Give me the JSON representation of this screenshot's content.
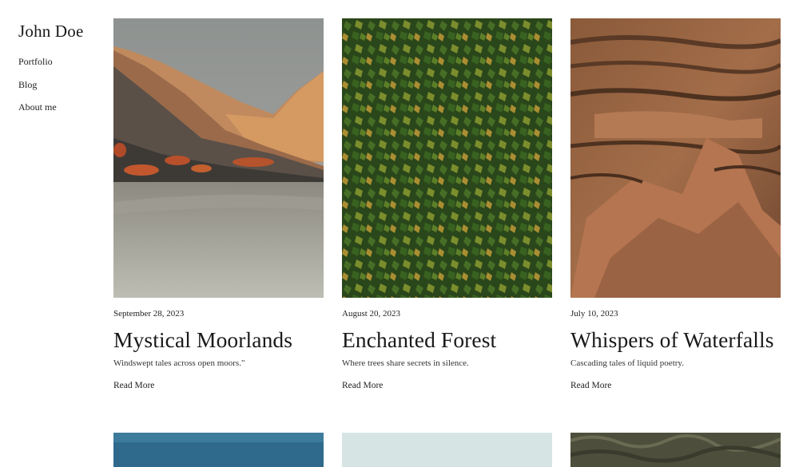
{
  "site": {
    "title": "John Doe"
  },
  "nav": {
    "items": [
      {
        "label": "Portfolio"
      },
      {
        "label": "Blog"
      },
      {
        "label": "About me"
      }
    ]
  },
  "posts": [
    {
      "date": "September 28, 2023",
      "title": "Mystical Moorlands",
      "excerpt": "Windswept tales across open moors.\"",
      "read_more": "Read More",
      "image": "mountain-valley-photo"
    },
    {
      "date": "August 20, 2023",
      "title": "Enchanted Forest",
      "excerpt": "Where trees share secrets in silence.",
      "read_more": "Read More",
      "image": "green-leaves-photo"
    },
    {
      "date": "July 10, 2023",
      "title": "Whispers of Waterfalls",
      "excerpt": "Cascading tales of liquid poetry.",
      "read_more": "Read More",
      "image": "tree-bark-photo"
    }
  ],
  "colors": {
    "text": "#1a1a1a",
    "background": "#ffffff"
  }
}
